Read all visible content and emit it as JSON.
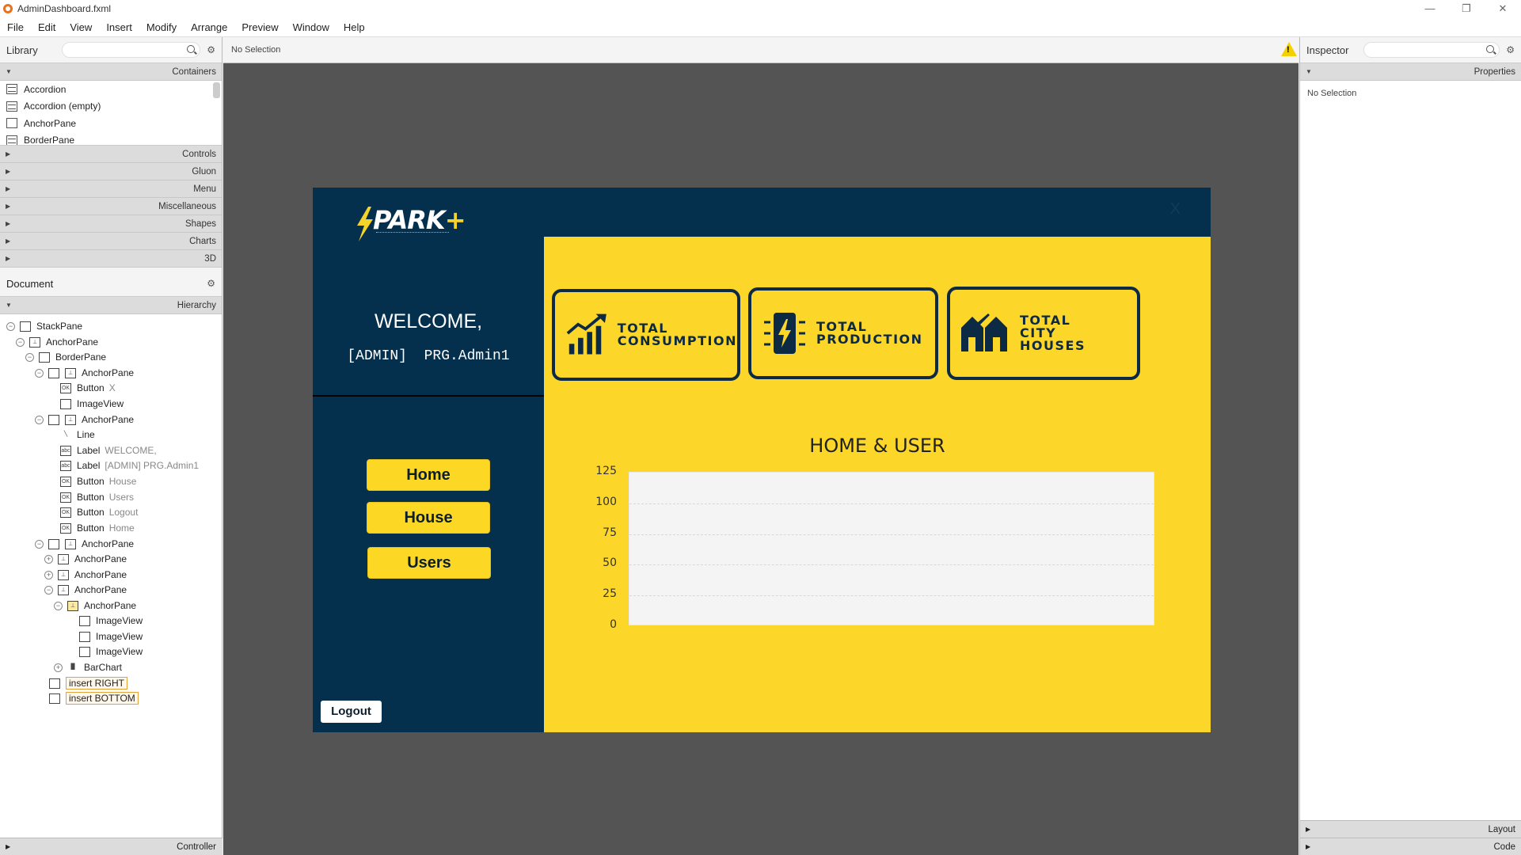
{
  "window": {
    "title": "AdminDashboard.fxml",
    "controls": [
      "—",
      "❐",
      "✕"
    ]
  },
  "menu": [
    "File",
    "Edit",
    "View",
    "Insert",
    "Modify",
    "Arrange",
    "Preview",
    "Window",
    "Help"
  ],
  "library": {
    "title": "Library",
    "sections_top": "Containers",
    "items": [
      "Accordion",
      "Accordion  (empty)",
      "AnchorPane",
      "BorderPane"
    ],
    "sections": [
      "Controls",
      "Gluon",
      "Menu",
      "Miscellaneous",
      "Shapes",
      "Charts",
      "3D"
    ]
  },
  "document": {
    "title": "Document",
    "hierarchy_label": "Hierarchy",
    "tree": [
      {
        "label": "StackPane",
        "sub": ""
      },
      {
        "label": "AnchorPane",
        "sub": ""
      },
      {
        "label": "BorderPane",
        "sub": ""
      },
      {
        "label": "AnchorPane",
        "sub": ""
      },
      {
        "label": "Button",
        "sub": "X"
      },
      {
        "label": "ImageView",
        "sub": ""
      },
      {
        "label": "AnchorPane",
        "sub": ""
      },
      {
        "label": "Line",
        "sub": ""
      },
      {
        "label": "Label",
        "sub": "WELCOME,"
      },
      {
        "label": "Label",
        "sub": "[ADMIN]  PRG.Admin1"
      },
      {
        "label": "Button",
        "sub": "House"
      },
      {
        "label": "Button",
        "sub": "Users"
      },
      {
        "label": "Button",
        "sub": "Logout"
      },
      {
        "label": "Button",
        "sub": "Home"
      },
      {
        "label": "AnchorPane",
        "sub": ""
      },
      {
        "label": "AnchorPane",
        "sub": ""
      },
      {
        "label": "AnchorPane",
        "sub": ""
      },
      {
        "label": "AnchorPane",
        "sub": ""
      },
      {
        "label": "AnchorPane",
        "sub": ""
      },
      {
        "label": "ImageView",
        "sub": ""
      },
      {
        "label": "ImageView",
        "sub": ""
      },
      {
        "label": "ImageView",
        "sub": ""
      },
      {
        "label": "BarChart",
        "sub": ""
      },
      {
        "label": "insert RIGHT",
        "sub": ""
      },
      {
        "label": "insert BOTTOM",
        "sub": ""
      }
    ],
    "controller_label": "Controller"
  },
  "center": {
    "status": "No Selection"
  },
  "inspector": {
    "title": "Inspector",
    "properties_label": "Properties",
    "content": "No Selection",
    "layout_label": "Layout",
    "code_label": "Code"
  },
  "app": {
    "logo_text": "PARK",
    "logo_plus": "+",
    "close": "X",
    "welcome": "WELCOME,",
    "admin_line": "[ADMIN]  PRG.Admin1",
    "nav": [
      "Home",
      "House",
      "Users"
    ],
    "logout": "Logout",
    "cards": [
      "TOTAL\nCONSUMPTION",
      "TOTAL\nPRODUCTION",
      "TOTAL\nCITY\nHOUSES"
    ],
    "colors": {
      "navy": "#04304d",
      "yellow": "#fcd629"
    }
  },
  "chart_data": {
    "type": "bar",
    "title": "HOME & USER",
    "categories": [],
    "series": [],
    "ylim": [
      0,
      125
    ],
    "yticks": [
      125,
      100,
      75,
      50,
      25,
      0
    ],
    "grid": true
  }
}
